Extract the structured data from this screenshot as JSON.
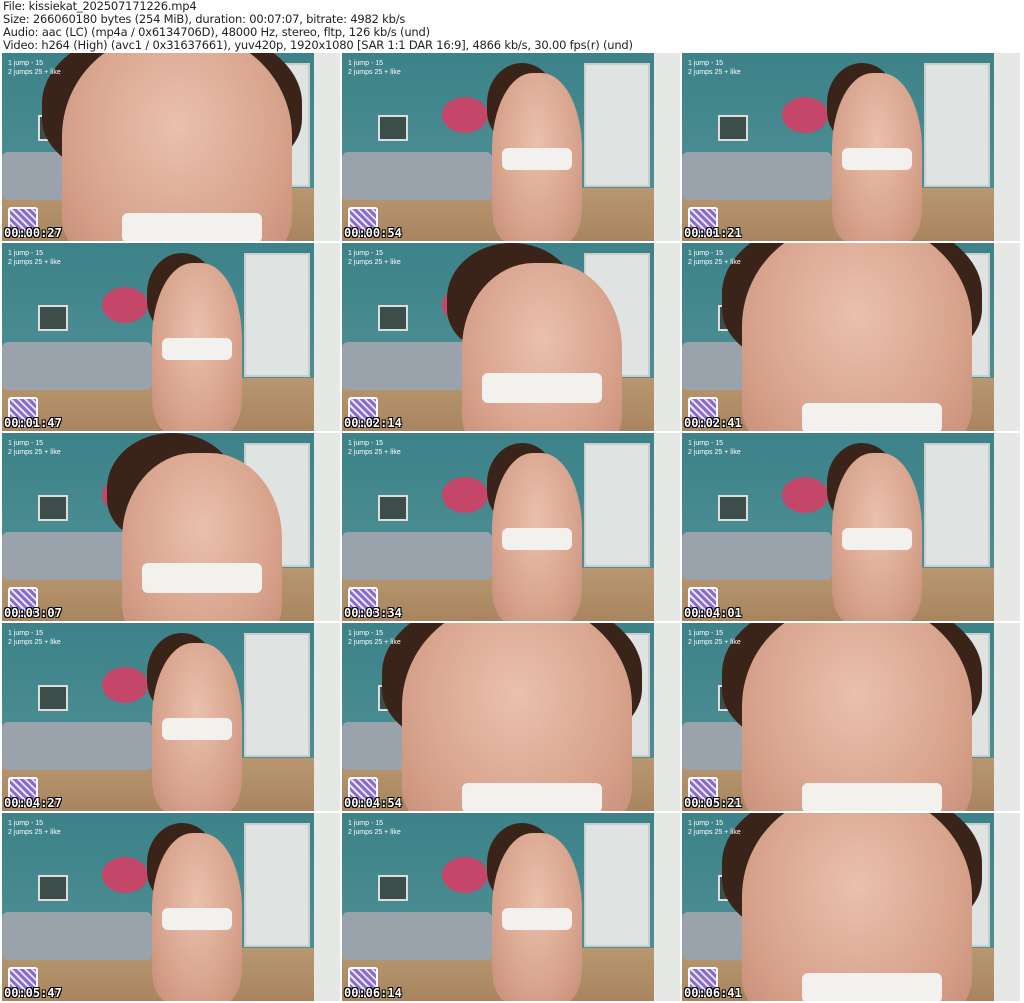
{
  "header": {
    "file": "File: kissiekat_202507171226.mp4",
    "size": "Size: 266060180 bytes (254 MiB), duration: 00:07:07, bitrate: 4982 kb/s",
    "audio": "Audio: aac (LC) (mp4a / 0x6134706D), 48000 Hz, stereo, fltp, 126 kb/s (und)",
    "video": "Video: h264 (High) (avc1 / 0x31637661), yuv420p, 1920x1080 [SAR 1:1 DAR 16:9], 4866 kb/s, 30.00 fps(r) (und)"
  },
  "overlay": {
    "line1": "1 jump - 15",
    "line2": "2 jumps 25 + like"
  },
  "thumbnails": [
    {
      "timestamp": "00:00:27",
      "view": "close"
    },
    {
      "timestamp": "00:00:54",
      "view": "wide"
    },
    {
      "timestamp": "00:01:21",
      "view": "wide"
    },
    {
      "timestamp": "00:01:47",
      "view": "wide"
    },
    {
      "timestamp": "00:02:14",
      "view": "mid"
    },
    {
      "timestamp": "00:02:41",
      "view": "close"
    },
    {
      "timestamp": "00:03:07",
      "view": "mid"
    },
    {
      "timestamp": "00:03:34",
      "view": "wide"
    },
    {
      "timestamp": "00:04:01",
      "view": "wide"
    },
    {
      "timestamp": "00:04:27",
      "view": "wide"
    },
    {
      "timestamp": "00:04:54",
      "view": "close"
    },
    {
      "timestamp": "00:05:21",
      "view": "close"
    },
    {
      "timestamp": "00:05:47",
      "view": "wide"
    },
    {
      "timestamp": "00:06:14",
      "view": "wide"
    },
    {
      "timestamp": "00:06:41",
      "view": "close"
    }
  ]
}
